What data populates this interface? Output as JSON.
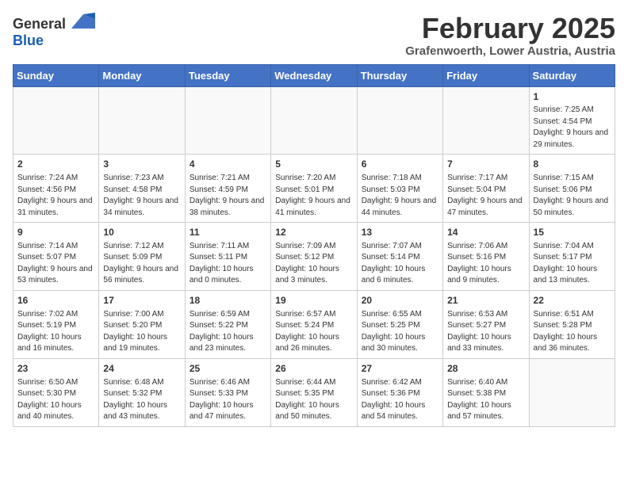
{
  "header": {
    "logo_general": "General",
    "logo_blue": "Blue",
    "title": "February 2025",
    "location": "Grafenwoerth, Lower Austria, Austria"
  },
  "days_of_week": [
    "Sunday",
    "Monday",
    "Tuesday",
    "Wednesday",
    "Thursday",
    "Friday",
    "Saturday"
  ],
  "weeks": [
    [
      {
        "day": "",
        "info": ""
      },
      {
        "day": "",
        "info": ""
      },
      {
        "day": "",
        "info": ""
      },
      {
        "day": "",
        "info": ""
      },
      {
        "day": "",
        "info": ""
      },
      {
        "day": "",
        "info": ""
      },
      {
        "day": "1",
        "info": "Sunrise: 7:25 AM\nSunset: 4:54 PM\nDaylight: 9 hours and 29 minutes."
      }
    ],
    [
      {
        "day": "2",
        "info": "Sunrise: 7:24 AM\nSunset: 4:56 PM\nDaylight: 9 hours and 31 minutes."
      },
      {
        "day": "3",
        "info": "Sunrise: 7:23 AM\nSunset: 4:58 PM\nDaylight: 9 hours and 34 minutes."
      },
      {
        "day": "4",
        "info": "Sunrise: 7:21 AM\nSunset: 4:59 PM\nDaylight: 9 hours and 38 minutes."
      },
      {
        "day": "5",
        "info": "Sunrise: 7:20 AM\nSunset: 5:01 PM\nDaylight: 9 hours and 41 minutes."
      },
      {
        "day": "6",
        "info": "Sunrise: 7:18 AM\nSunset: 5:03 PM\nDaylight: 9 hours and 44 minutes."
      },
      {
        "day": "7",
        "info": "Sunrise: 7:17 AM\nSunset: 5:04 PM\nDaylight: 9 hours and 47 minutes."
      },
      {
        "day": "8",
        "info": "Sunrise: 7:15 AM\nSunset: 5:06 PM\nDaylight: 9 hours and 50 minutes."
      }
    ],
    [
      {
        "day": "9",
        "info": "Sunrise: 7:14 AM\nSunset: 5:07 PM\nDaylight: 9 hours and 53 minutes."
      },
      {
        "day": "10",
        "info": "Sunrise: 7:12 AM\nSunset: 5:09 PM\nDaylight: 9 hours and 56 minutes."
      },
      {
        "day": "11",
        "info": "Sunrise: 7:11 AM\nSunset: 5:11 PM\nDaylight: 10 hours and 0 minutes."
      },
      {
        "day": "12",
        "info": "Sunrise: 7:09 AM\nSunset: 5:12 PM\nDaylight: 10 hours and 3 minutes."
      },
      {
        "day": "13",
        "info": "Sunrise: 7:07 AM\nSunset: 5:14 PM\nDaylight: 10 hours and 6 minutes."
      },
      {
        "day": "14",
        "info": "Sunrise: 7:06 AM\nSunset: 5:16 PM\nDaylight: 10 hours and 9 minutes."
      },
      {
        "day": "15",
        "info": "Sunrise: 7:04 AM\nSunset: 5:17 PM\nDaylight: 10 hours and 13 minutes."
      }
    ],
    [
      {
        "day": "16",
        "info": "Sunrise: 7:02 AM\nSunset: 5:19 PM\nDaylight: 10 hours and 16 minutes."
      },
      {
        "day": "17",
        "info": "Sunrise: 7:00 AM\nSunset: 5:20 PM\nDaylight: 10 hours and 19 minutes."
      },
      {
        "day": "18",
        "info": "Sunrise: 6:59 AM\nSunset: 5:22 PM\nDaylight: 10 hours and 23 minutes."
      },
      {
        "day": "19",
        "info": "Sunrise: 6:57 AM\nSunset: 5:24 PM\nDaylight: 10 hours and 26 minutes."
      },
      {
        "day": "20",
        "info": "Sunrise: 6:55 AM\nSunset: 5:25 PM\nDaylight: 10 hours and 30 minutes."
      },
      {
        "day": "21",
        "info": "Sunrise: 6:53 AM\nSunset: 5:27 PM\nDaylight: 10 hours and 33 minutes."
      },
      {
        "day": "22",
        "info": "Sunrise: 6:51 AM\nSunset: 5:28 PM\nDaylight: 10 hours and 36 minutes."
      }
    ],
    [
      {
        "day": "23",
        "info": "Sunrise: 6:50 AM\nSunset: 5:30 PM\nDaylight: 10 hours and 40 minutes."
      },
      {
        "day": "24",
        "info": "Sunrise: 6:48 AM\nSunset: 5:32 PM\nDaylight: 10 hours and 43 minutes."
      },
      {
        "day": "25",
        "info": "Sunrise: 6:46 AM\nSunset: 5:33 PM\nDaylight: 10 hours and 47 minutes."
      },
      {
        "day": "26",
        "info": "Sunrise: 6:44 AM\nSunset: 5:35 PM\nDaylight: 10 hours and 50 minutes."
      },
      {
        "day": "27",
        "info": "Sunrise: 6:42 AM\nSunset: 5:36 PM\nDaylight: 10 hours and 54 minutes."
      },
      {
        "day": "28",
        "info": "Sunrise: 6:40 AM\nSunset: 5:38 PM\nDaylight: 10 hours and 57 minutes."
      },
      {
        "day": "",
        "info": ""
      }
    ]
  ]
}
